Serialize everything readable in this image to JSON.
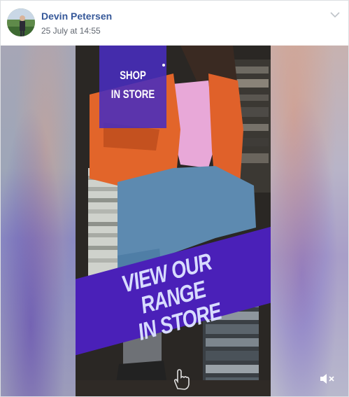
{
  "post": {
    "author_name": "Devin Petersen",
    "timestamp": "25 July at 14:55",
    "menu_icon": "chevron-down-icon"
  },
  "media": {
    "overlay_top": {
      "line1": "SHOP",
      "line2": "IN STORE"
    },
    "banner": {
      "line1": "VIEW OUR RANGE",
      "line2": "IN STORE"
    },
    "icons": {
      "cursor": "hand-pointer-icon",
      "sound": "speaker-muted-icon"
    },
    "colors": {
      "overlay_purple": "#4a20b8",
      "jacket_orange": "#e2652a",
      "author_blue": "#365899"
    }
  }
}
